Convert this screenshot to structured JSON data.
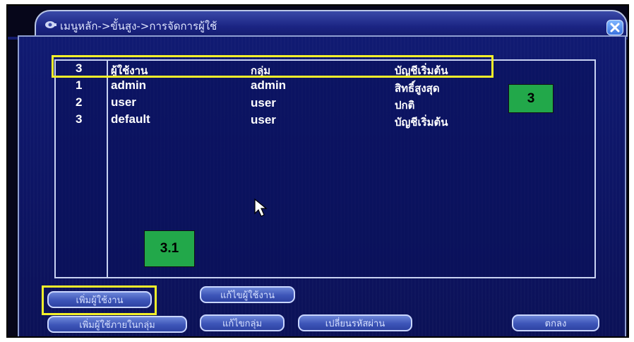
{
  "window": {
    "breadcrumb": "เมนูหลัก->ขั้นสูง->การจัดการผู้ใช้"
  },
  "table": {
    "header": [
      "3",
      "ผู้ใช้งาน",
      "กลุ่ม",
      "บัญชีเริ่มต้น"
    ],
    "rows": [
      [
        "1",
        "admin",
        "admin",
        "สิทธิ์สูงสุด"
      ],
      [
        "2",
        "user",
        "user",
        "ปกติ"
      ],
      [
        "3",
        "default",
        "user",
        "บัญชีเริ่มต้น"
      ]
    ]
  },
  "annotations": {
    "callout_list": "3",
    "callout_add": "3.1"
  },
  "buttons": {
    "add_user": "เพิ่มผู้ใช้งาน",
    "edit_user": "แก้ไขผู้ใช้งาน",
    "add_group": "เพิ่มผู้ใช้ภายในกลุ่ม",
    "edit_group": "แก้ไขกลุ่ม",
    "change_password": "เปลี่ยนรหัสผ่าน",
    "ok": "ตกลง"
  },
  "icons": {
    "title": "camera-icon",
    "close": "close-icon",
    "pointer": "mouse-pointer-icon"
  },
  "colors": {
    "window_bg": "#0d1565",
    "highlight": "#f4f02a",
    "callout": "#22a84a"
  }
}
